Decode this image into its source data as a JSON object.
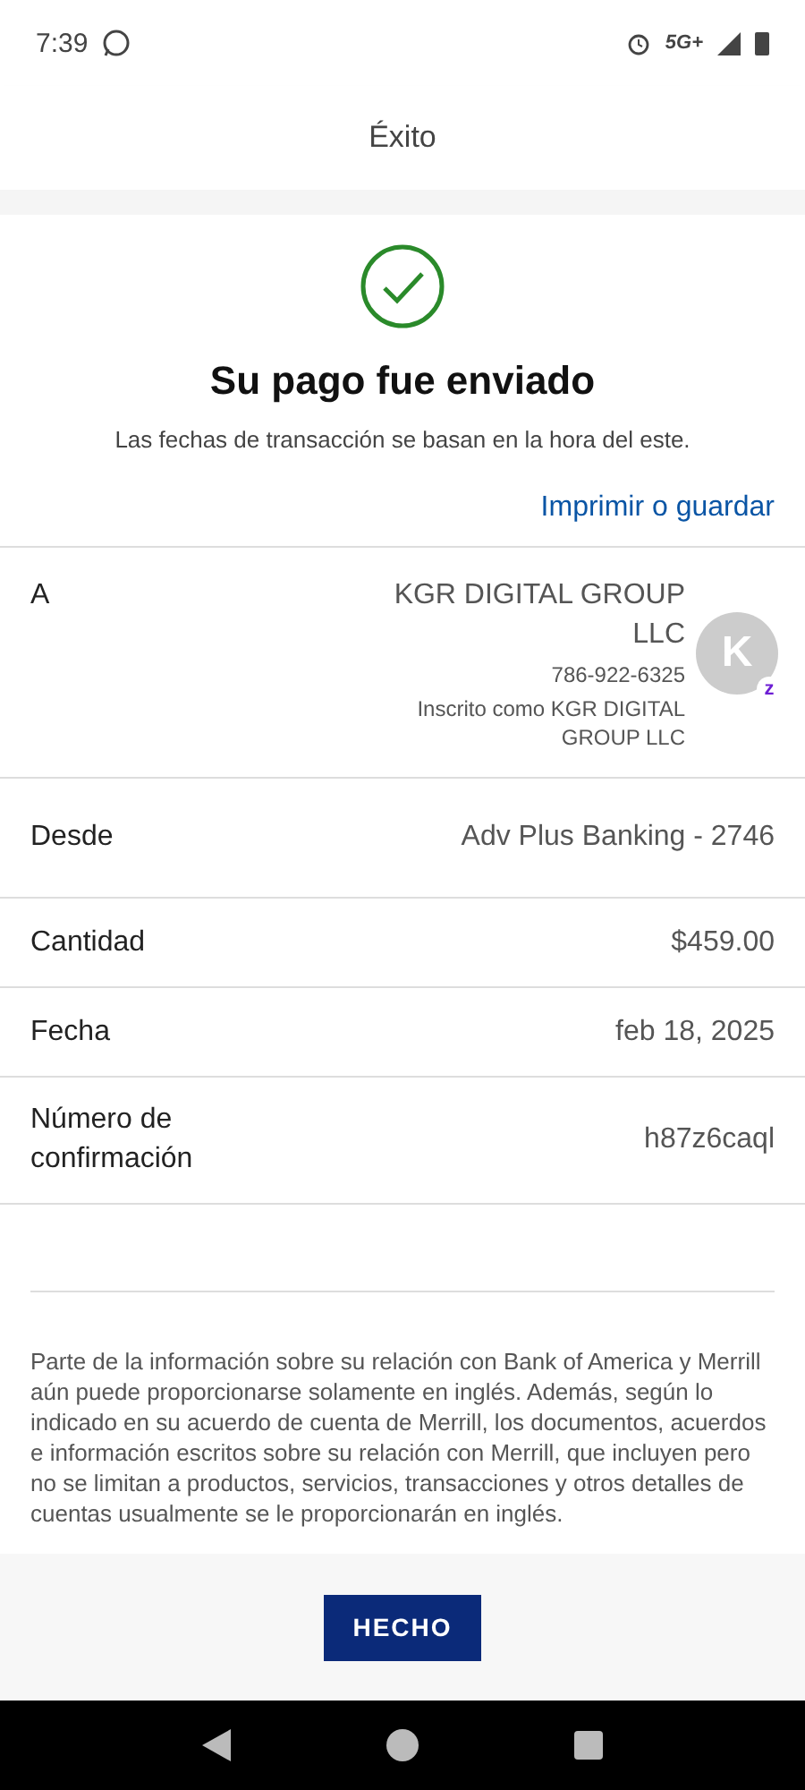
{
  "status_bar": {
    "time": "7:39",
    "network": "5G+"
  },
  "header": {
    "title": "Éxito"
  },
  "confirmation": {
    "heading": "Su pago fue enviado",
    "subtitle": "Las fechas de transacción se basan en la hora del este.",
    "print_link": "Imprimir o guardar"
  },
  "recipient": {
    "label": "A",
    "name": "KGR DIGITAL GROUP LLC",
    "phone": "786-922-6325",
    "enrolled_as": "Inscrito como KGR DIGITAL GROUP LLC",
    "avatar_letter": "K",
    "avatar_badge": "z"
  },
  "details": [
    {
      "label": "Desde",
      "value": "Adv Plus Banking - 2746"
    },
    {
      "label": "Cantidad",
      "value": "$459.00"
    },
    {
      "label": "Fecha",
      "value": "feb 18, 2025"
    },
    {
      "label": "Número de confirmación",
      "value": "h87z6caql"
    }
  ],
  "disclaimer": "Parte de la información sobre su relación con Bank of America y Merrill aún puede proporcionarse solamente en inglés. Además, según lo indicado en su acuerdo de cuenta de Merrill, los documentos, acuerdos e información escritos sobre su relación con Merrill, que incluyen pero no se limitan a productos, servicios, transacciones y otros detalles de cuentas usualmente se le proporcionarán en inglés.",
  "done_button": "HECHO"
}
